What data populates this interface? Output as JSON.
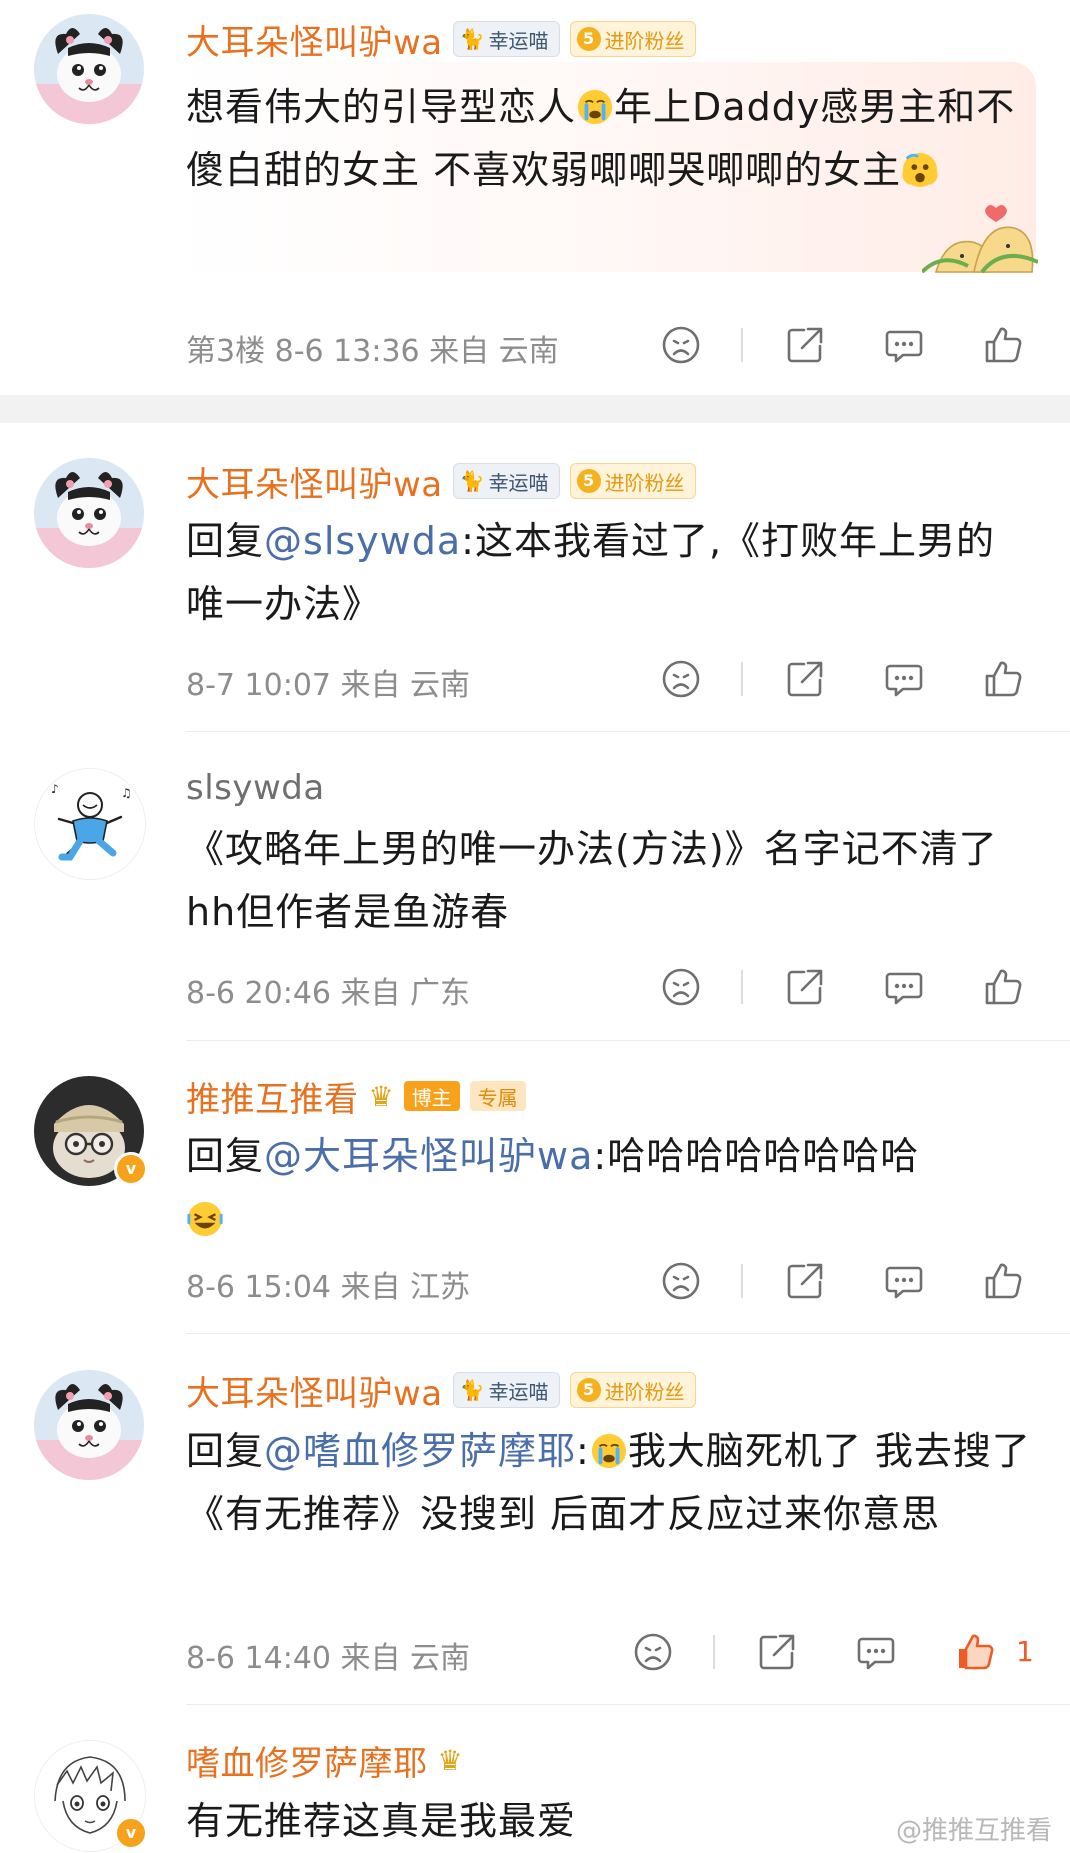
{
  "comments": [
    {
      "username": "大耳朵怪叫驴wa",
      "badges": {
        "lucky": "幸运喵",
        "fan_level": "5",
        "fan": "进阶粉丝"
      },
      "text_a": "想看伟大的引导型恋人",
      "emoji_1": "crying-face",
      "text_b": "年上Daddy感男主和不傻白甜的女主 不喜欢弱唧唧哭唧唧的女主",
      "emoji_2": "scared-face",
      "meta": "第3楼 8-6 13:36 来自 云南"
    },
    {
      "username": "大耳朵怪叫驴wa",
      "badges": {
        "lucky": "幸运喵",
        "fan_level": "5",
        "fan": "进阶粉丝"
      },
      "reply_prefix": "回复",
      "mention": "@slsywda",
      "text": ":这本我看过了,《打败年上男的唯一办法》",
      "meta": "8-7 10:07 来自 云南"
    },
    {
      "username": "slsywda",
      "text": "《攻略年上男的唯一办法(方法)》名字记不清了hh但作者是鱼游春",
      "meta": "8-6 20:46 来自 广东"
    },
    {
      "username": "推推互推看",
      "badges": {
        "blogger": "博主",
        "exclusive": "专属"
      },
      "reply_prefix": "回复",
      "mention": "@大耳朵怪叫驴wa",
      "text": ":哈哈哈哈哈哈哈哈",
      "emoji": "laughing-face",
      "meta": "8-6 15:04 来自 江苏"
    },
    {
      "username": "大耳朵怪叫驴wa",
      "badges": {
        "lucky": "幸运喵",
        "fan_level": "5",
        "fan": "进阶粉丝"
      },
      "reply_prefix": "回复",
      "mention": "@嗜血修罗萨摩耶",
      "text_a": ":",
      "emoji": "crying-face",
      "text_b": "我大脑死机了 我去搜了《有无推荐》没搜到 后面才反应过来你意思",
      "meta": "8-6 14:40 来自 云南",
      "like_count": "1"
    },
    {
      "username": "嗜血修罗萨摩耶",
      "text": "有无推荐这真是我最爱"
    }
  ],
  "watermark": "@推推互推看",
  "colors": {
    "username": "#e8701e",
    "mention": "#4a6ea9",
    "like_active": "#f05a24",
    "meta": "#8d8d8d"
  }
}
